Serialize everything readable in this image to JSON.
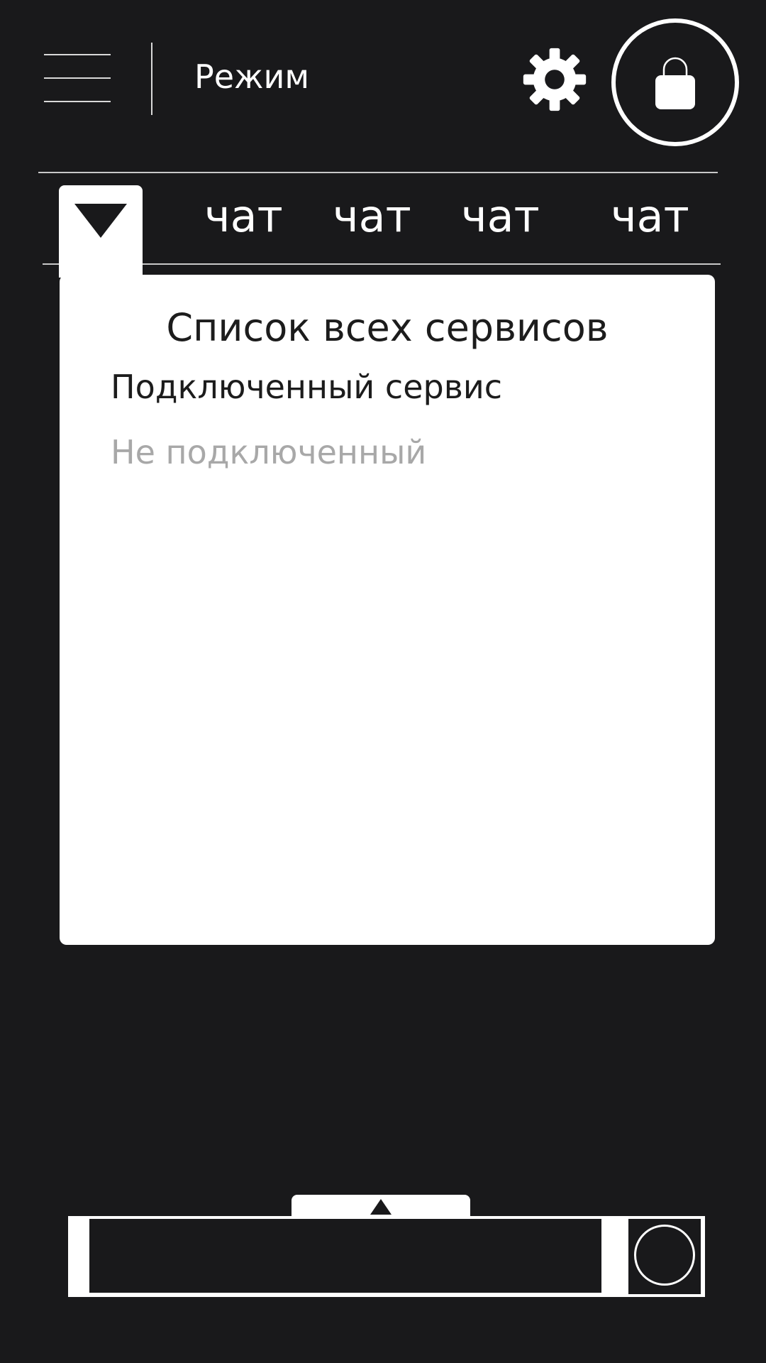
{
  "header": {
    "menu_icon": "hamburger-menu-icon",
    "mode_label": "Режим",
    "settings_icon": "gear-icon",
    "lock_icon": "lock-icon"
  },
  "tabs": {
    "dropdown_icon": "triangle-down-icon",
    "items": [
      {
        "label": "чат"
      },
      {
        "label": "чат"
      },
      {
        "label": "чат"
      },
      {
        "label": "чат"
      }
    ]
  },
  "services_panel": {
    "title": "Список всех сервисов",
    "connected_label": "Подключенный сервис",
    "disconnected_label": "Не подключенный"
  },
  "composer": {
    "expand_icon": "triangle-up-icon",
    "send_icon": "circle-icon"
  },
  "colors": {
    "background": "#19191b",
    "foreground": "#ffffff",
    "muted_text": "#a8a8a8",
    "panel_text": "#1c1c1c"
  }
}
